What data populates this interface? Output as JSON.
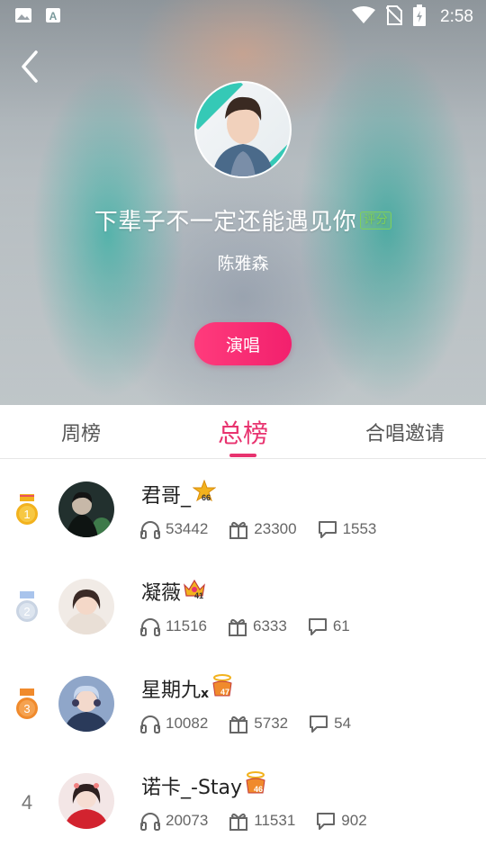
{
  "status_bar": {
    "time": "2:58",
    "icons": [
      "image-icon",
      "text-icon",
      "wifi-icon",
      "no-sim-icon",
      "battery-icon"
    ]
  },
  "header": {
    "song_title": "下辈子不一定还能遇见你",
    "song_tag": "评分",
    "artist": "陈雅森",
    "sing_button": "演唱"
  },
  "tabs": [
    {
      "label": "周榜",
      "active": false
    },
    {
      "label": "总榜",
      "active": true
    },
    {
      "label": "合唱邀请",
      "active": false
    }
  ],
  "ranking": [
    {
      "rank": "1",
      "medal": "gold",
      "name": "君哥_",
      "suffix": "",
      "level": "66",
      "listens": "53442",
      "gifts": "23300",
      "comments": "1553"
    },
    {
      "rank": "2",
      "medal": "silver",
      "name": "凝薇",
      "suffix": "",
      "level": "41",
      "listens": "11516",
      "gifts": "6333",
      "comments": "61"
    },
    {
      "rank": "3",
      "medal": "bronze",
      "name": "星期九",
      "suffix": "x",
      "level": "47",
      "listens": "10082",
      "gifts": "5732",
      "comments": "54"
    },
    {
      "rank": "4",
      "medal": "none",
      "name": "诺卡_-Stay",
      "suffix": "",
      "level": "46",
      "listens": "20073",
      "gifts": "11531",
      "comments": "902"
    }
  ],
  "colors": {
    "accent": "#e8336f",
    "tag_green": "#7fd05a",
    "gold": "#f2b21e",
    "silver": "#c9d4e3",
    "bronze": "#f08a2c"
  }
}
